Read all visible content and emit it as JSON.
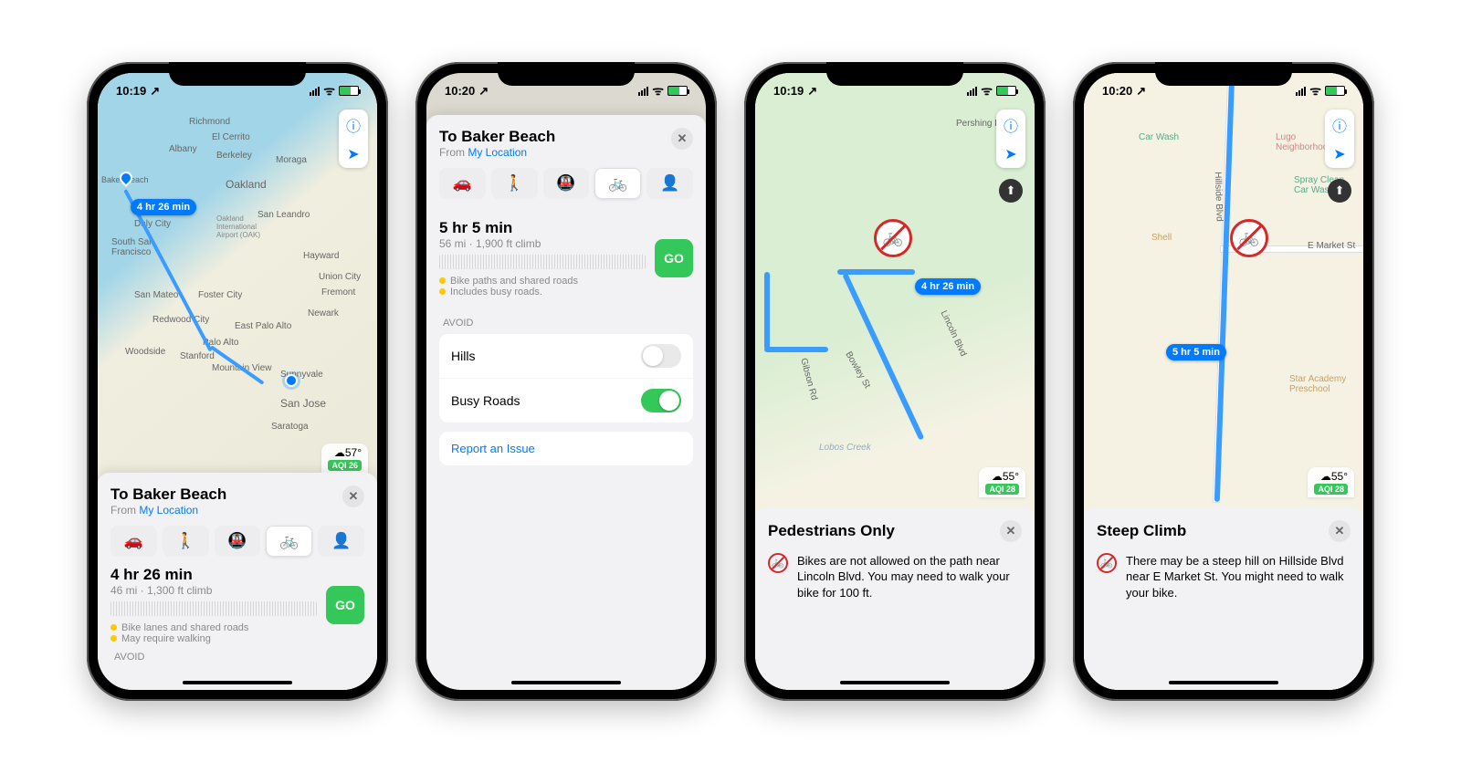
{
  "phones": [
    {
      "status": {
        "time": "10:19",
        "loc_arrow": "↗",
        "battery_pct": 60
      },
      "weather": {
        "temp": "57°",
        "icon": "☁",
        "aqi": "AQI 26"
      },
      "map_labels": [
        "Richmond",
        "El Cerrito",
        "Albany",
        "Berkeley",
        "Moraga",
        "Oakland",
        "San Leandro",
        "Hayward",
        "Daly City",
        "South San Francisco",
        "San Mateo",
        "Foster City",
        "Redwood City",
        "Palo Alto",
        "Stanford",
        "Woodside",
        "Mountain View",
        "Sunnyvale",
        "San Jose",
        "Saratoga",
        "Fremont",
        "Union City",
        "Newark",
        "East Palo Alto",
        "Baker Beach",
        "Oakland International Airport (OAK)"
      ],
      "route_bubble": "4 hr 26 min",
      "card": {
        "title": "To Baker Beach",
        "from_label": "From ",
        "from_link": "My Location",
        "modes": [
          "car",
          "walk",
          "transit",
          "bike",
          "rideshare"
        ],
        "selected_mode": "bike",
        "route": {
          "time": "4 hr 26 min",
          "dist": "46 mi · 1,300 ft climb",
          "go": "GO"
        },
        "notes": [
          "Bike lanes and shared roads",
          "May require walking"
        ],
        "avoid_label": "AVOID"
      }
    },
    {
      "status": {
        "time": "10:20",
        "loc_arrow": "↗"
      },
      "card": {
        "title": "To Baker Beach",
        "from_label": "From ",
        "from_link": "My Location",
        "modes": [
          "car",
          "walk",
          "transit",
          "bike",
          "rideshare"
        ],
        "selected_mode": "bike",
        "route": {
          "time": "5 hr 5 min",
          "dist": "56 mi · 1,900 ft climb",
          "go": "GO"
        },
        "notes": [
          "Bike paths and shared roads",
          "Includes busy roads."
        ],
        "avoid_label": "AVOID",
        "toggles": [
          {
            "label": "Hills",
            "on": false
          },
          {
            "label": "Busy Roads",
            "on": true
          }
        ],
        "report_link": "Report an Issue"
      }
    },
    {
      "status": {
        "time": "10:19",
        "loc_arrow": "↗"
      },
      "weather": {
        "temp": "55°",
        "icon": "☁",
        "aqi": "AQI 28"
      },
      "route_bubble": "4 hr 26 min",
      "map_labels": [
        "Pershing Dr",
        "Lincoln Blvd",
        "Bowley St",
        "Gibson Rd",
        "Lobos Creek"
      ],
      "sign": "no-bike",
      "alert": {
        "title": "Pedestrians Only",
        "body": "Bikes are not allowed on the path near Lincoln Blvd. You may need to walk your bike for 100 ft."
      }
    },
    {
      "status": {
        "time": "10:20",
        "loc_arrow": "↗"
      },
      "weather": {
        "temp": "55°",
        "icon": "☁",
        "aqi": "AQI 28"
      },
      "route_bubble": "5 hr 5 min",
      "map_labels": [
        "Hillside Blvd",
        "E Market St",
        "Lugo Neighborhood",
        "Spray Clean Car Wash",
        "Star Academy Preschool",
        "Shell",
        "Car Wash"
      ],
      "sign": "steep-climb",
      "alert": {
        "title": "Steep Climb",
        "body": "There may be a steep hill on Hillside Blvd near E Market St. You might need to walk your bike."
      }
    }
  ]
}
